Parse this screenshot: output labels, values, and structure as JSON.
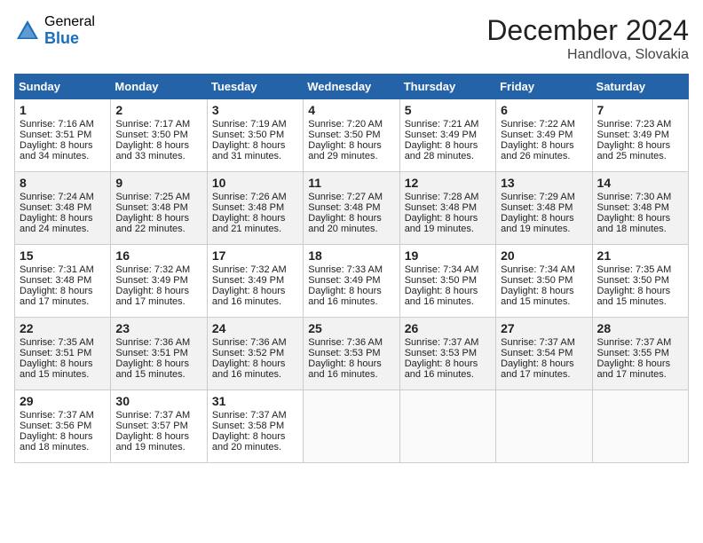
{
  "header": {
    "logo_general": "General",
    "logo_blue": "Blue",
    "title": "December 2024",
    "location": "Handlova, Slovakia"
  },
  "days_of_week": [
    "Sunday",
    "Monday",
    "Tuesday",
    "Wednesday",
    "Thursday",
    "Friday",
    "Saturday"
  ],
  "weeks": [
    [
      {
        "day": "1",
        "sunrise": "Sunrise: 7:16 AM",
        "sunset": "Sunset: 3:51 PM",
        "daylight": "Daylight: 8 hours and 34 minutes."
      },
      {
        "day": "2",
        "sunrise": "Sunrise: 7:17 AM",
        "sunset": "Sunset: 3:50 PM",
        "daylight": "Daylight: 8 hours and 33 minutes."
      },
      {
        "day": "3",
        "sunrise": "Sunrise: 7:19 AM",
        "sunset": "Sunset: 3:50 PM",
        "daylight": "Daylight: 8 hours and 31 minutes."
      },
      {
        "day": "4",
        "sunrise": "Sunrise: 7:20 AM",
        "sunset": "Sunset: 3:50 PM",
        "daylight": "Daylight: 8 hours and 29 minutes."
      },
      {
        "day": "5",
        "sunrise": "Sunrise: 7:21 AM",
        "sunset": "Sunset: 3:49 PM",
        "daylight": "Daylight: 8 hours and 28 minutes."
      },
      {
        "day": "6",
        "sunrise": "Sunrise: 7:22 AM",
        "sunset": "Sunset: 3:49 PM",
        "daylight": "Daylight: 8 hours and 26 minutes."
      },
      {
        "day": "7",
        "sunrise": "Sunrise: 7:23 AM",
        "sunset": "Sunset: 3:49 PM",
        "daylight": "Daylight: 8 hours and 25 minutes."
      }
    ],
    [
      {
        "day": "8",
        "sunrise": "Sunrise: 7:24 AM",
        "sunset": "Sunset: 3:48 PM",
        "daylight": "Daylight: 8 hours and 24 minutes."
      },
      {
        "day": "9",
        "sunrise": "Sunrise: 7:25 AM",
        "sunset": "Sunset: 3:48 PM",
        "daylight": "Daylight: 8 hours and 22 minutes."
      },
      {
        "day": "10",
        "sunrise": "Sunrise: 7:26 AM",
        "sunset": "Sunset: 3:48 PM",
        "daylight": "Daylight: 8 hours and 21 minutes."
      },
      {
        "day": "11",
        "sunrise": "Sunrise: 7:27 AM",
        "sunset": "Sunset: 3:48 PM",
        "daylight": "Daylight: 8 hours and 20 minutes."
      },
      {
        "day": "12",
        "sunrise": "Sunrise: 7:28 AM",
        "sunset": "Sunset: 3:48 PM",
        "daylight": "Daylight: 8 hours and 19 minutes."
      },
      {
        "day": "13",
        "sunrise": "Sunrise: 7:29 AM",
        "sunset": "Sunset: 3:48 PM",
        "daylight": "Daylight: 8 hours and 19 minutes."
      },
      {
        "day": "14",
        "sunrise": "Sunrise: 7:30 AM",
        "sunset": "Sunset: 3:48 PM",
        "daylight": "Daylight: 8 hours and 18 minutes."
      }
    ],
    [
      {
        "day": "15",
        "sunrise": "Sunrise: 7:31 AM",
        "sunset": "Sunset: 3:48 PM",
        "daylight": "Daylight: 8 hours and 17 minutes."
      },
      {
        "day": "16",
        "sunrise": "Sunrise: 7:32 AM",
        "sunset": "Sunset: 3:49 PM",
        "daylight": "Daylight: 8 hours and 17 minutes."
      },
      {
        "day": "17",
        "sunrise": "Sunrise: 7:32 AM",
        "sunset": "Sunset: 3:49 PM",
        "daylight": "Daylight: 8 hours and 16 minutes."
      },
      {
        "day": "18",
        "sunrise": "Sunrise: 7:33 AM",
        "sunset": "Sunset: 3:49 PM",
        "daylight": "Daylight: 8 hours and 16 minutes."
      },
      {
        "day": "19",
        "sunrise": "Sunrise: 7:34 AM",
        "sunset": "Sunset: 3:50 PM",
        "daylight": "Daylight: 8 hours and 16 minutes."
      },
      {
        "day": "20",
        "sunrise": "Sunrise: 7:34 AM",
        "sunset": "Sunset: 3:50 PM",
        "daylight": "Daylight: 8 hours and 15 minutes."
      },
      {
        "day": "21",
        "sunrise": "Sunrise: 7:35 AM",
        "sunset": "Sunset: 3:50 PM",
        "daylight": "Daylight: 8 hours and 15 minutes."
      }
    ],
    [
      {
        "day": "22",
        "sunrise": "Sunrise: 7:35 AM",
        "sunset": "Sunset: 3:51 PM",
        "daylight": "Daylight: 8 hours and 15 minutes."
      },
      {
        "day": "23",
        "sunrise": "Sunrise: 7:36 AM",
        "sunset": "Sunset: 3:51 PM",
        "daylight": "Daylight: 8 hours and 15 minutes."
      },
      {
        "day": "24",
        "sunrise": "Sunrise: 7:36 AM",
        "sunset": "Sunset: 3:52 PM",
        "daylight": "Daylight: 8 hours and 16 minutes."
      },
      {
        "day": "25",
        "sunrise": "Sunrise: 7:36 AM",
        "sunset": "Sunset: 3:53 PM",
        "daylight": "Daylight: 8 hours and 16 minutes."
      },
      {
        "day": "26",
        "sunrise": "Sunrise: 7:37 AM",
        "sunset": "Sunset: 3:53 PM",
        "daylight": "Daylight: 8 hours and 16 minutes."
      },
      {
        "day": "27",
        "sunrise": "Sunrise: 7:37 AM",
        "sunset": "Sunset: 3:54 PM",
        "daylight": "Daylight: 8 hours and 17 minutes."
      },
      {
        "day": "28",
        "sunrise": "Sunrise: 7:37 AM",
        "sunset": "Sunset: 3:55 PM",
        "daylight": "Daylight: 8 hours and 17 minutes."
      }
    ],
    [
      {
        "day": "29",
        "sunrise": "Sunrise: 7:37 AM",
        "sunset": "Sunset: 3:56 PM",
        "daylight": "Daylight: 8 hours and 18 minutes."
      },
      {
        "day": "30",
        "sunrise": "Sunrise: 7:37 AM",
        "sunset": "Sunset: 3:57 PM",
        "daylight": "Daylight: 8 hours and 19 minutes."
      },
      {
        "day": "31",
        "sunrise": "Sunrise: 7:37 AM",
        "sunset": "Sunset: 3:58 PM",
        "daylight": "Daylight: 8 hours and 20 minutes."
      },
      null,
      null,
      null,
      null
    ]
  ]
}
